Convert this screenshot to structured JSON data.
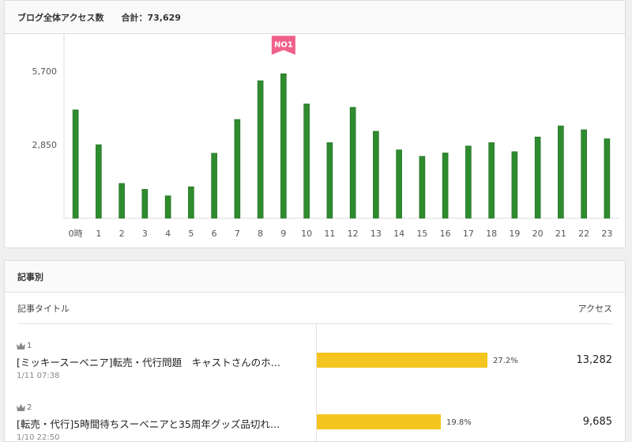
{
  "chart_panel": {
    "title": "ブログ全体アクセス数",
    "total_label": "合計：73,629",
    "badge": "NO1"
  },
  "chart_data": {
    "type": "bar",
    "categories": [
      "0時",
      "1",
      "2",
      "3",
      "4",
      "5",
      "6",
      "7",
      "8",
      "9",
      "10",
      "11",
      "12",
      "13",
      "14",
      "15",
      "16",
      "17",
      "18",
      "19",
      "20",
      "21",
      "22",
      "23"
    ],
    "values": [
      4200,
      2850,
      1350,
      1120,
      870,
      1220,
      2520,
      3830,
      5330,
      5600,
      4430,
      2930,
      4300,
      3370,
      2650,
      2400,
      2530,
      2800,
      2930,
      2580,
      3150,
      3580,
      3430,
      3080
    ],
    "yticks": [
      "5,700",
      "2,850"
    ],
    "ytick_values": [
      5700,
      2850
    ],
    "ylim": [
      0,
      6000
    ],
    "highlight_index": 9,
    "grid": false
  },
  "articles_panel": {
    "title": "記事別",
    "col_title": "記事タイトル",
    "col_access": "アクセス",
    "rows": [
      {
        "rank": "1",
        "title": "[ミッキースーベニア]転売・代行問題　キャストさんのホ…",
        "date": "1/11 07:38",
        "percent_label": "27.2%",
        "percent": 27.2,
        "count": "13,282"
      },
      {
        "rank": "2",
        "title": "[転売・代行]5時間待ちスーベニアと35周年グッズ品切れ…",
        "date": "1/10 22:50",
        "percent_label": "19.8%",
        "percent": 19.8,
        "count": "9,685"
      }
    ]
  }
}
